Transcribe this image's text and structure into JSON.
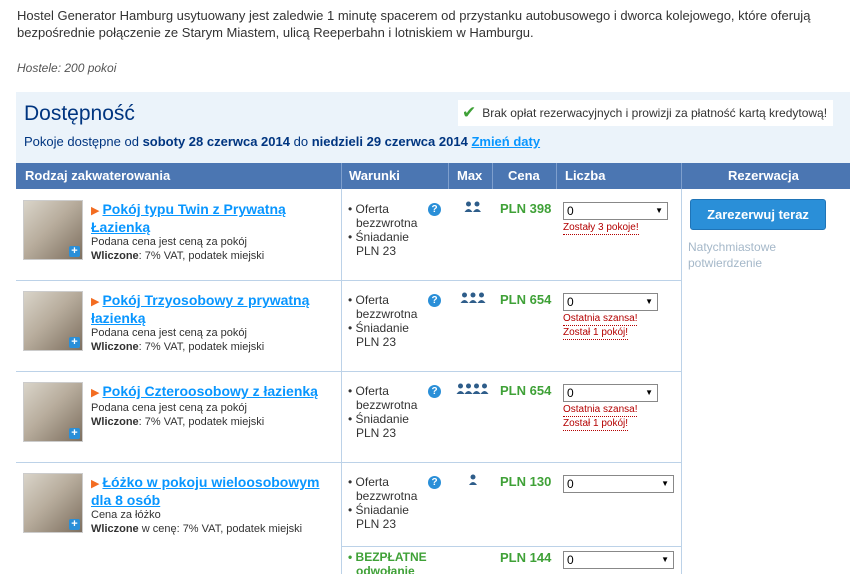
{
  "intro": {
    "description": "Hostel Generator Hamburg usytuowany jest zaledwie 1 minutę spacerem od przystanku autobusowego i dworca kolejowego, które oferują bezpośrednie połączenie ze Starym Miastem, ulicą Reeperbahn i lotniskiem w Hamburgu.",
    "hostels_count": "Hostele: 200 pokoi"
  },
  "availability": {
    "title": "Dostępność",
    "dates_prefix": "Pokoje dostępne od",
    "date_from": "soboty 28 czerwca 2014",
    "dates_mid": "do",
    "date_to": "niedzieli 29 czerwca 2014",
    "change_dates": "Zmień daty",
    "no_fees": "Brak opłat rezerwacyjnych i prowizji za płatność kartą kredytową!"
  },
  "table": {
    "headers": {
      "type": "Rodzaj zakwaterowania",
      "conditions": "Warunki",
      "max": "Max",
      "price": "Cena",
      "quantity": "Liczba",
      "reservation": "Rezerwacja"
    }
  },
  "rooms": [
    {
      "name": "Pokój typu Twin z Prywatną Łazienką",
      "note1": "Podana cena jest ceną za pokój",
      "included_label": "Wliczone",
      "included": ": 7% VAT, podatek miejski",
      "cond_a": "• Oferta bezzwrotna",
      "cond_b": "• Śniadanie PLN 23",
      "max_icon": "2-persons-icon",
      "price": "PLN 398",
      "qty": "0",
      "warn1": "Zostały 3 pokoje!",
      "warn2": ""
    },
    {
      "name": "Pokój Trzyosobowy z prywatną łazienką",
      "note1": "Podana cena jest ceną za pokój",
      "included_label": "Wliczone",
      "included": ": 7% VAT, podatek miejski",
      "cond_a": "• Oferta bezzwrotna",
      "cond_b": "• Śniadanie PLN 23",
      "max_icon": "3-persons-icon",
      "price": "PLN 654",
      "qty": "0",
      "warn1": "Ostatnia szansa!",
      "warn2": "Został 1 pokój!"
    },
    {
      "name": "Pokój Czteroosobowy z łazienką",
      "note1": "Podana cena jest ceną za pokój",
      "included_label": "Wliczone",
      "included": ": 7% VAT, podatek miejski",
      "cond_a": "• Oferta bezzwrotna",
      "cond_b": "• Śniadanie PLN 23",
      "max_icon": "4-persons-icon",
      "price": "PLN 654",
      "qty": "0",
      "warn1": "Ostatnia szansa!",
      "warn2": "Został 1 pokój!"
    },
    {
      "name": "Łóżko w pokoju wieloosobowym dla 8 osób",
      "note1": "Cena za łóżko",
      "included_label": "Wliczone",
      "included": " w cenę: 7% VAT, podatek miejski",
      "cond_a": "• Oferta bezzwrotna",
      "cond_b": "• Śniadanie PLN 23",
      "max_icon": "1-person-icon",
      "price": "PLN 130",
      "qty": "0",
      "extra_cond": "• BEZPŁATNE odwołanie",
      "extra_price": "PLN 144",
      "extra_qty": "0"
    }
  ],
  "reservation": {
    "book_button": "Zarezerwuj teraz",
    "instant": "Natychmiastowe potwierdzenie"
  },
  "colors": {
    "brand_blue": "#003580",
    "header_blue": "#4b76b2",
    "link_blue": "#0896ff",
    "price_green": "#3fa137",
    "warn_red": "#b40000"
  }
}
